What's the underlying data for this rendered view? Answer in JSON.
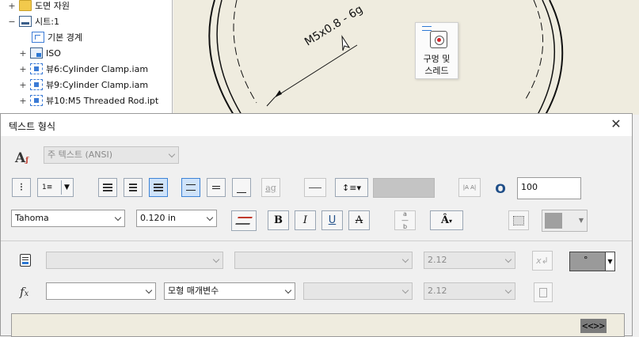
{
  "browser": {
    "items": [
      {
        "expander": "+",
        "label": "도면 자원",
        "icon": "folder-icon"
      },
      {
        "expander": "−",
        "label": "시트:1",
        "icon": "sheet-icon"
      },
      {
        "expander": "",
        "label": "기본 경계",
        "icon": "border-icon"
      },
      {
        "expander": "+",
        "label": "ISO",
        "icon": "title-block-icon"
      },
      {
        "expander": "+",
        "label": "뷰6:Cylinder Clamp.iam",
        "icon": "drawing-view-icon"
      },
      {
        "expander": "+",
        "label": "뷰9:Cylinder Clamp.iam",
        "icon": "drawing-view-icon"
      },
      {
        "expander": "+",
        "label": "뷰10:M5 Threaded Rod.ipt",
        "icon": "drawing-view-icon"
      }
    ]
  },
  "canvas": {
    "annotation": "M5x0.8 - 6g",
    "tooltip_label_line1": "구멍 및",
    "tooltip_label_line2": "스레드",
    "tooltip_icon": "hole-thread-icon"
  },
  "dialog": {
    "title": "텍스트 형식",
    "close_glyph": "✕",
    "style_combo": "주 텍스트 (ANSI)",
    "font_combo": "Tahoma",
    "size_combo": "0.120 in",
    "stretch_value": "100",
    "bold_label": "B",
    "italic_label": "I",
    "underline_label": "U",
    "strike_label": "A",
    "symbol_combo_text": "°",
    "precision_1": "2.12",
    "precision_2": "2.12",
    "param_combo_2": "모형 매개변수",
    "field_token": "<<>>",
    "colors": {
      "active_button": "#cfe3fa",
      "accent": "#3d83d6",
      "canvas_bg": "#efecdf",
      "color_swatch": "#a0a0a0"
    }
  }
}
